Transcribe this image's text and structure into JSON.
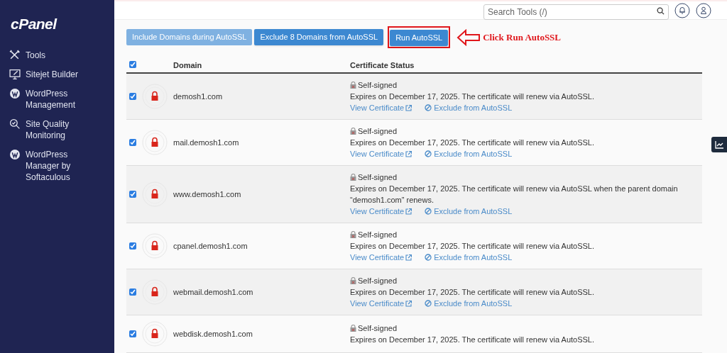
{
  "sidebar": {
    "logo": "cPanel",
    "items": [
      {
        "kind": "tools",
        "label": "Tools"
      },
      {
        "kind": "monitor",
        "label": "Sitejet Builder"
      },
      {
        "kind": "wordpress",
        "label": "WordPress Management"
      },
      {
        "kind": "magnifier",
        "label": "Site Quality Monitoring"
      },
      {
        "kind": "wordpress",
        "label": "WordPress Manager by Softaculous"
      }
    ]
  },
  "header": {
    "search": {
      "placeholder": "Search Tools (/)"
    }
  },
  "actions": [
    {
      "label": "Include Domains during AutoSSL",
      "disabled": true
    },
    {
      "label": "Exclude 8 Domains from AutoSSL",
      "disabled": false
    },
    {
      "label": "Run AutoSSL",
      "disabled": false
    }
  ],
  "annotation": {
    "text": "Click Run AutoSSL"
  },
  "table": {
    "select_all_checked": true,
    "columns": [
      "Domain",
      "Certificate Status"
    ],
    "rows": [
      {
        "checked": true,
        "domain": "demosh1.com",
        "status": "Self-signed",
        "message": "Expires on December 17, 2025. The certificate will renew via AutoSSL.",
        "view_link": "View Certificate",
        "exclude_link": "Exclude from AutoSSL"
      },
      {
        "checked": true,
        "domain": "mail.demosh1.com",
        "status": "Self-signed",
        "message": "Expires on December 17, 2025. The certificate will renew via AutoSSL.",
        "view_link": "View Certificate",
        "exclude_link": "Exclude from AutoSSL"
      },
      {
        "checked": true,
        "domain": "www.demosh1.com",
        "status": "Self-signed",
        "message": "Expires on December 17, 2025. The certificate will renew via AutoSSL when the parent domain “demosh1.com” renews.",
        "view_link": "View Certificate",
        "exclude_link": "Exclude from AutoSSL"
      },
      {
        "checked": true,
        "domain": "cpanel.demosh1.com",
        "status": "Self-signed",
        "message": "Expires on December 17, 2025. The certificate will renew via AutoSSL.",
        "view_link": "View Certificate",
        "exclude_link": "Exclude from AutoSSL"
      },
      {
        "checked": true,
        "domain": "webmail.demosh1.com",
        "status": "Self-signed",
        "message": "Expires on December 17, 2025. The certificate will renew via AutoSSL.",
        "view_link": "View Certificate",
        "exclude_link": "Exclude from AutoSSL"
      },
      {
        "checked": true,
        "domain": "webdisk.demosh1.com",
        "status": "Self-signed",
        "message": "Expires on December 17, 2025. The certificate will renew via AutoSSL."
      }
    ]
  }
}
